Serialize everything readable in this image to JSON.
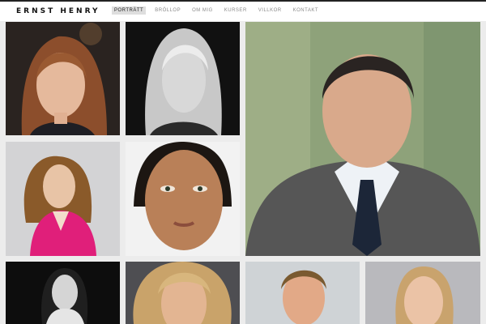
{
  "site": {
    "logo": "ERNST HENRY"
  },
  "nav": {
    "items": [
      {
        "label": "PORTRÄTT",
        "active": true
      },
      {
        "label": "BRÖLLOP",
        "active": false
      },
      {
        "label": "OM MIG",
        "active": false
      },
      {
        "label": "KURSER",
        "active": false
      },
      {
        "label": "VILLKOR",
        "active": false
      },
      {
        "label": "KONTAKT",
        "active": false
      }
    ]
  },
  "gallery": {
    "photos": [
      {
        "subject": "woman-auburn-hair",
        "style": "color"
      },
      {
        "subject": "woman-blonde-hair",
        "style": "black-and-white"
      },
      {
        "subject": "man-suit-polka-dot-tie",
        "style": "color"
      },
      {
        "subject": "woman-curly-hair-pink-blazer",
        "style": "color"
      },
      {
        "subject": "woman-close-up-face",
        "style": "color"
      },
      {
        "subject": "woman-dark-hair",
        "style": "black-and-white"
      },
      {
        "subject": "woman-blonde-hair-close-up",
        "style": "color"
      },
      {
        "subject": "man-short-hair",
        "style": "color"
      },
      {
        "subject": "woman-blonde-hair-grey-background",
        "style": "color"
      }
    ]
  }
}
